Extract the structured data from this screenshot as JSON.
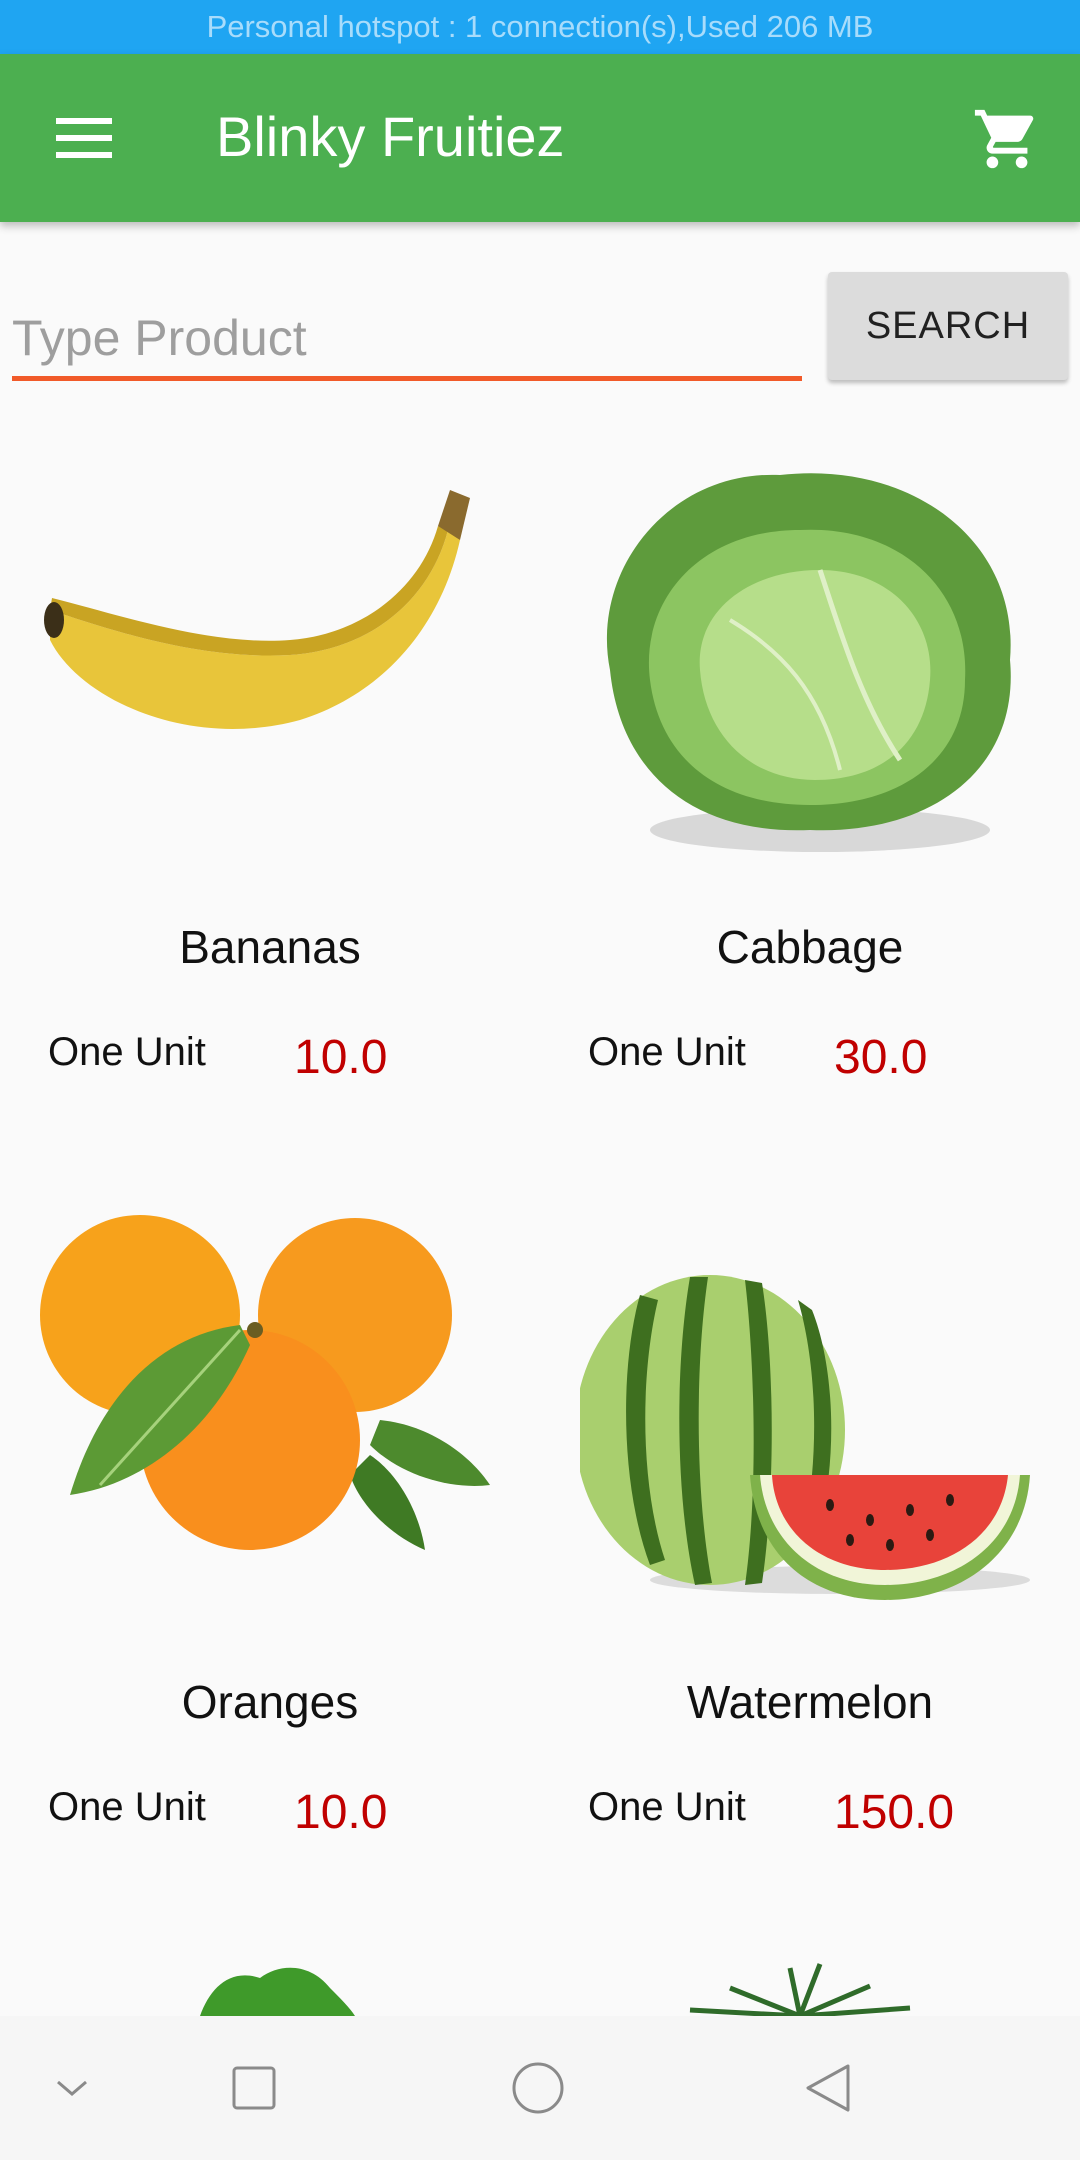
{
  "status_bar": {
    "text": "Personal hotspot : 1 connection(s),Used  206 MB"
  },
  "toolbar": {
    "title": "Blinky Fruitiez",
    "menu_icon": "menu-icon",
    "cart_icon": "cart-icon"
  },
  "search": {
    "placeholder": "Type Product",
    "value": "",
    "button_label": "SEARCH"
  },
  "products": [
    {
      "name": "Bananas",
      "unit": "One Unit",
      "price": "10.0",
      "icon": "banana-image"
    },
    {
      "name": "Cabbage",
      "unit": "One Unit",
      "price": "30.0",
      "icon": "cabbage-image"
    },
    {
      "name": "Oranges",
      "unit": "One Unit",
      "price": "10.0",
      "icon": "oranges-image"
    },
    {
      "name": "Watermelon",
      "unit": "One Unit",
      "price": "150.0",
      "icon": "watermelon-image"
    }
  ],
  "colors": {
    "toolbar": "#4caf50",
    "status_bar": "#1fa5f2",
    "accent": "#f15a29",
    "price": "#c00000"
  },
  "nav_bar": {
    "icons": [
      "collapse-icon",
      "recents-icon",
      "home-icon",
      "back-icon"
    ]
  }
}
